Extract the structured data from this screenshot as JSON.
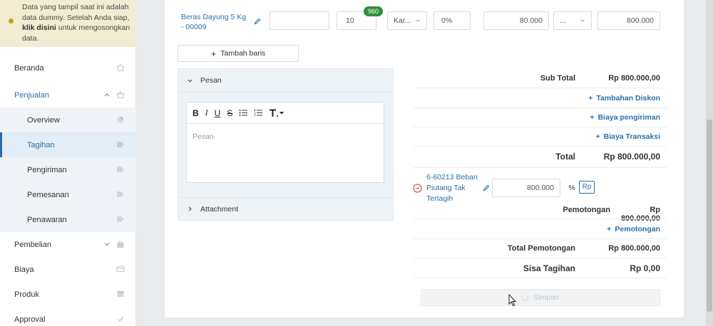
{
  "notice": {
    "text_before": "Data yang tampil saat ini adalah data dummy. Setelah Anda siap, ",
    "link": "klik disini",
    "text_after": " untuk mengosongkan data."
  },
  "sidebar": {
    "items": [
      {
        "label": "Beranda",
        "icon": "home-icon"
      },
      {
        "label": "Penjualan",
        "icon": "basket-icon"
      },
      {
        "label": "Overview",
        "icon": "pie-icon"
      },
      {
        "label": "Tagihan",
        "icon": "tag-icon"
      },
      {
        "label": "Pengiriman",
        "icon": "tag-icon"
      },
      {
        "label": "Pemesanan",
        "icon": "tag-icon"
      },
      {
        "label": "Penawaran",
        "icon": "tag-icon"
      },
      {
        "label": "Pembelian",
        "icon": "bag-icon"
      },
      {
        "label": "Biaya",
        "icon": "card-icon"
      },
      {
        "label": "Produk",
        "icon": "box-icon"
      },
      {
        "label": "Approval",
        "icon": "check-icon"
      }
    ]
  },
  "line_item": {
    "product": "Beras Dayung 5 Kg - 00009",
    "description": "",
    "qty": "10",
    "stock_badge": "960",
    "unit": "Kar...",
    "discount": "0%",
    "price": "80.000",
    "tax": "...",
    "amount": "800.000"
  },
  "add_row_label": "Tambah baris",
  "message_panel": {
    "title": "Pesan",
    "placeholder": "Pesan",
    "toolbar": [
      "B",
      "I",
      "U",
      "S"
    ]
  },
  "attachment_label": "Attachment",
  "summary": {
    "subtotal_label": "Sub Total",
    "subtotal_value": "Rp 800.000,00",
    "add_discount": "Tambahan Diskon",
    "shipping": "Biaya pengiriman",
    "transaction": "Biaya Transaksi",
    "total_label": "Total",
    "total_value": "Rp 800.000,00",
    "deduction_account": "6-60213 Beban Piutang Tak Tertagih",
    "deduction_amount": "800.000",
    "percent_label": "%",
    "rp_label": "Rp",
    "deduction_label": "Pemotongan",
    "deduction_value": "Rp 800.000,00",
    "add_deduction": "Pemotongan",
    "total_deduction_label": "Total Pemotongan",
    "total_deduction_value": "Rp 800.000,00",
    "remaining_label": "Sisa Tagihan",
    "remaining_value": "Rp 0,00"
  },
  "save_label": "Simpan",
  "colors": {
    "accent": "#2a6fa8",
    "badge": "#2f8f3a",
    "notice_bg": "#f2ecd2"
  }
}
